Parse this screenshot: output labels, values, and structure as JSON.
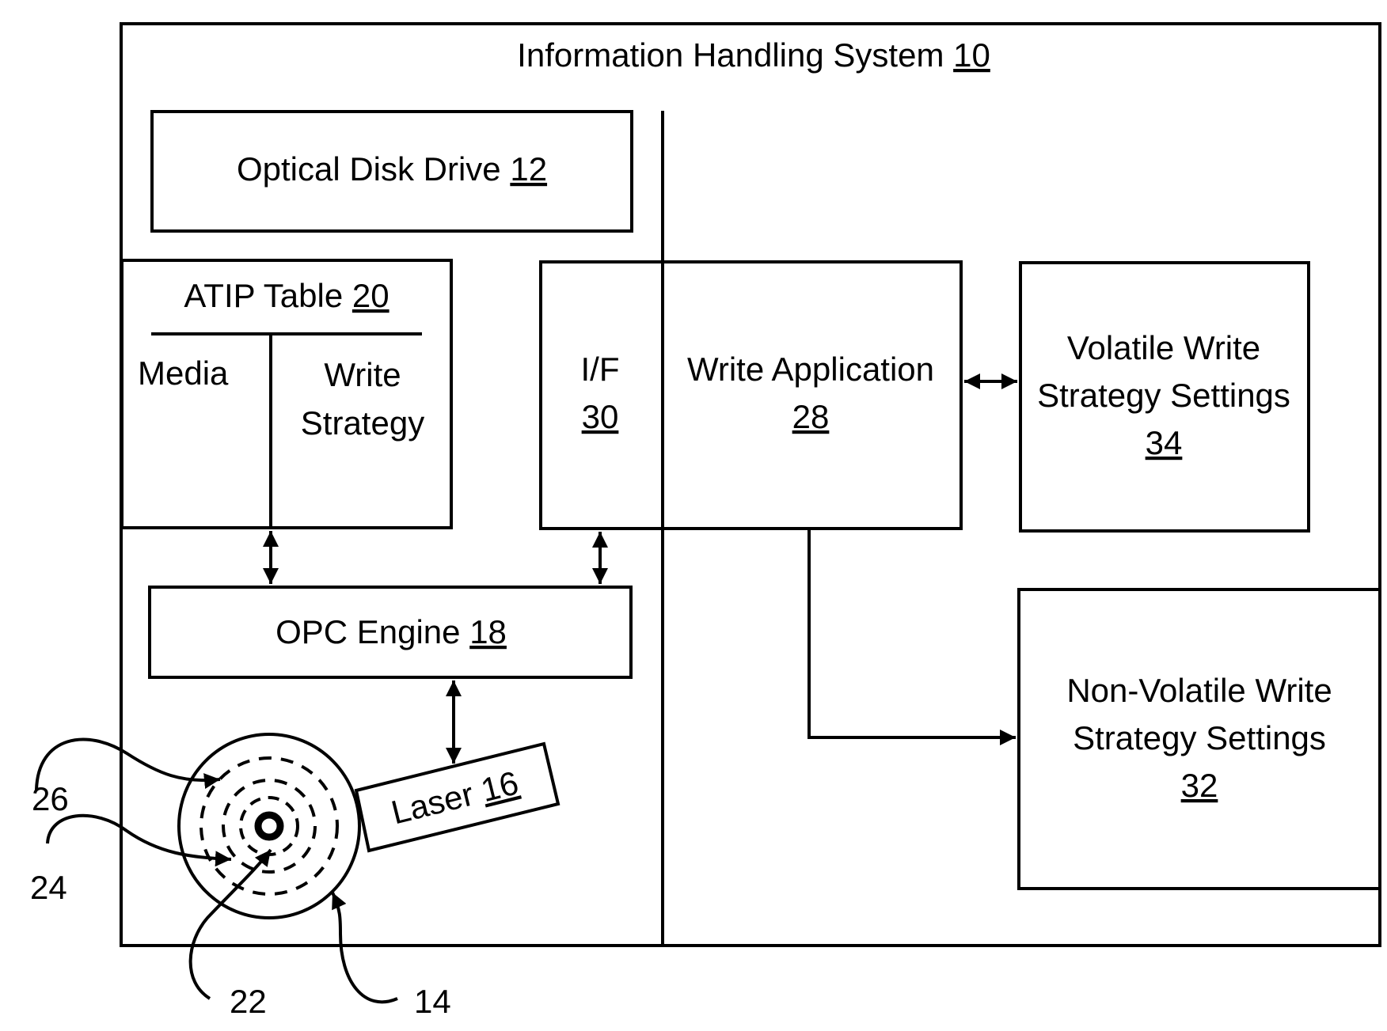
{
  "system": {
    "title": "Information Handling System",
    "ref": "10"
  },
  "optical_disk_drive": {
    "title": "Optical Disk Drive",
    "ref": "12"
  },
  "atip_table": {
    "title": "ATIP Table",
    "ref": "20",
    "col_media": "Media",
    "col_write_line1": "Write",
    "col_write_line2": "Strategy"
  },
  "interface": {
    "title": "I/F",
    "ref": "30"
  },
  "write_application": {
    "title": "Write Application",
    "ref": "28"
  },
  "volatile_settings": {
    "line1": "Volatile Write",
    "line2": "Strategy Settings",
    "ref": "34"
  },
  "nonvolatile_settings": {
    "line1": "Non-Volatile Write",
    "line2": "Strategy Settings",
    "ref": "32"
  },
  "opc_engine": {
    "title": "OPC Engine",
    "ref": "18"
  },
  "laser": {
    "title": "Laser",
    "ref": "16"
  },
  "callouts": {
    "disc": "14",
    "center": "22",
    "inner_track": "24",
    "outer_track": "26"
  }
}
